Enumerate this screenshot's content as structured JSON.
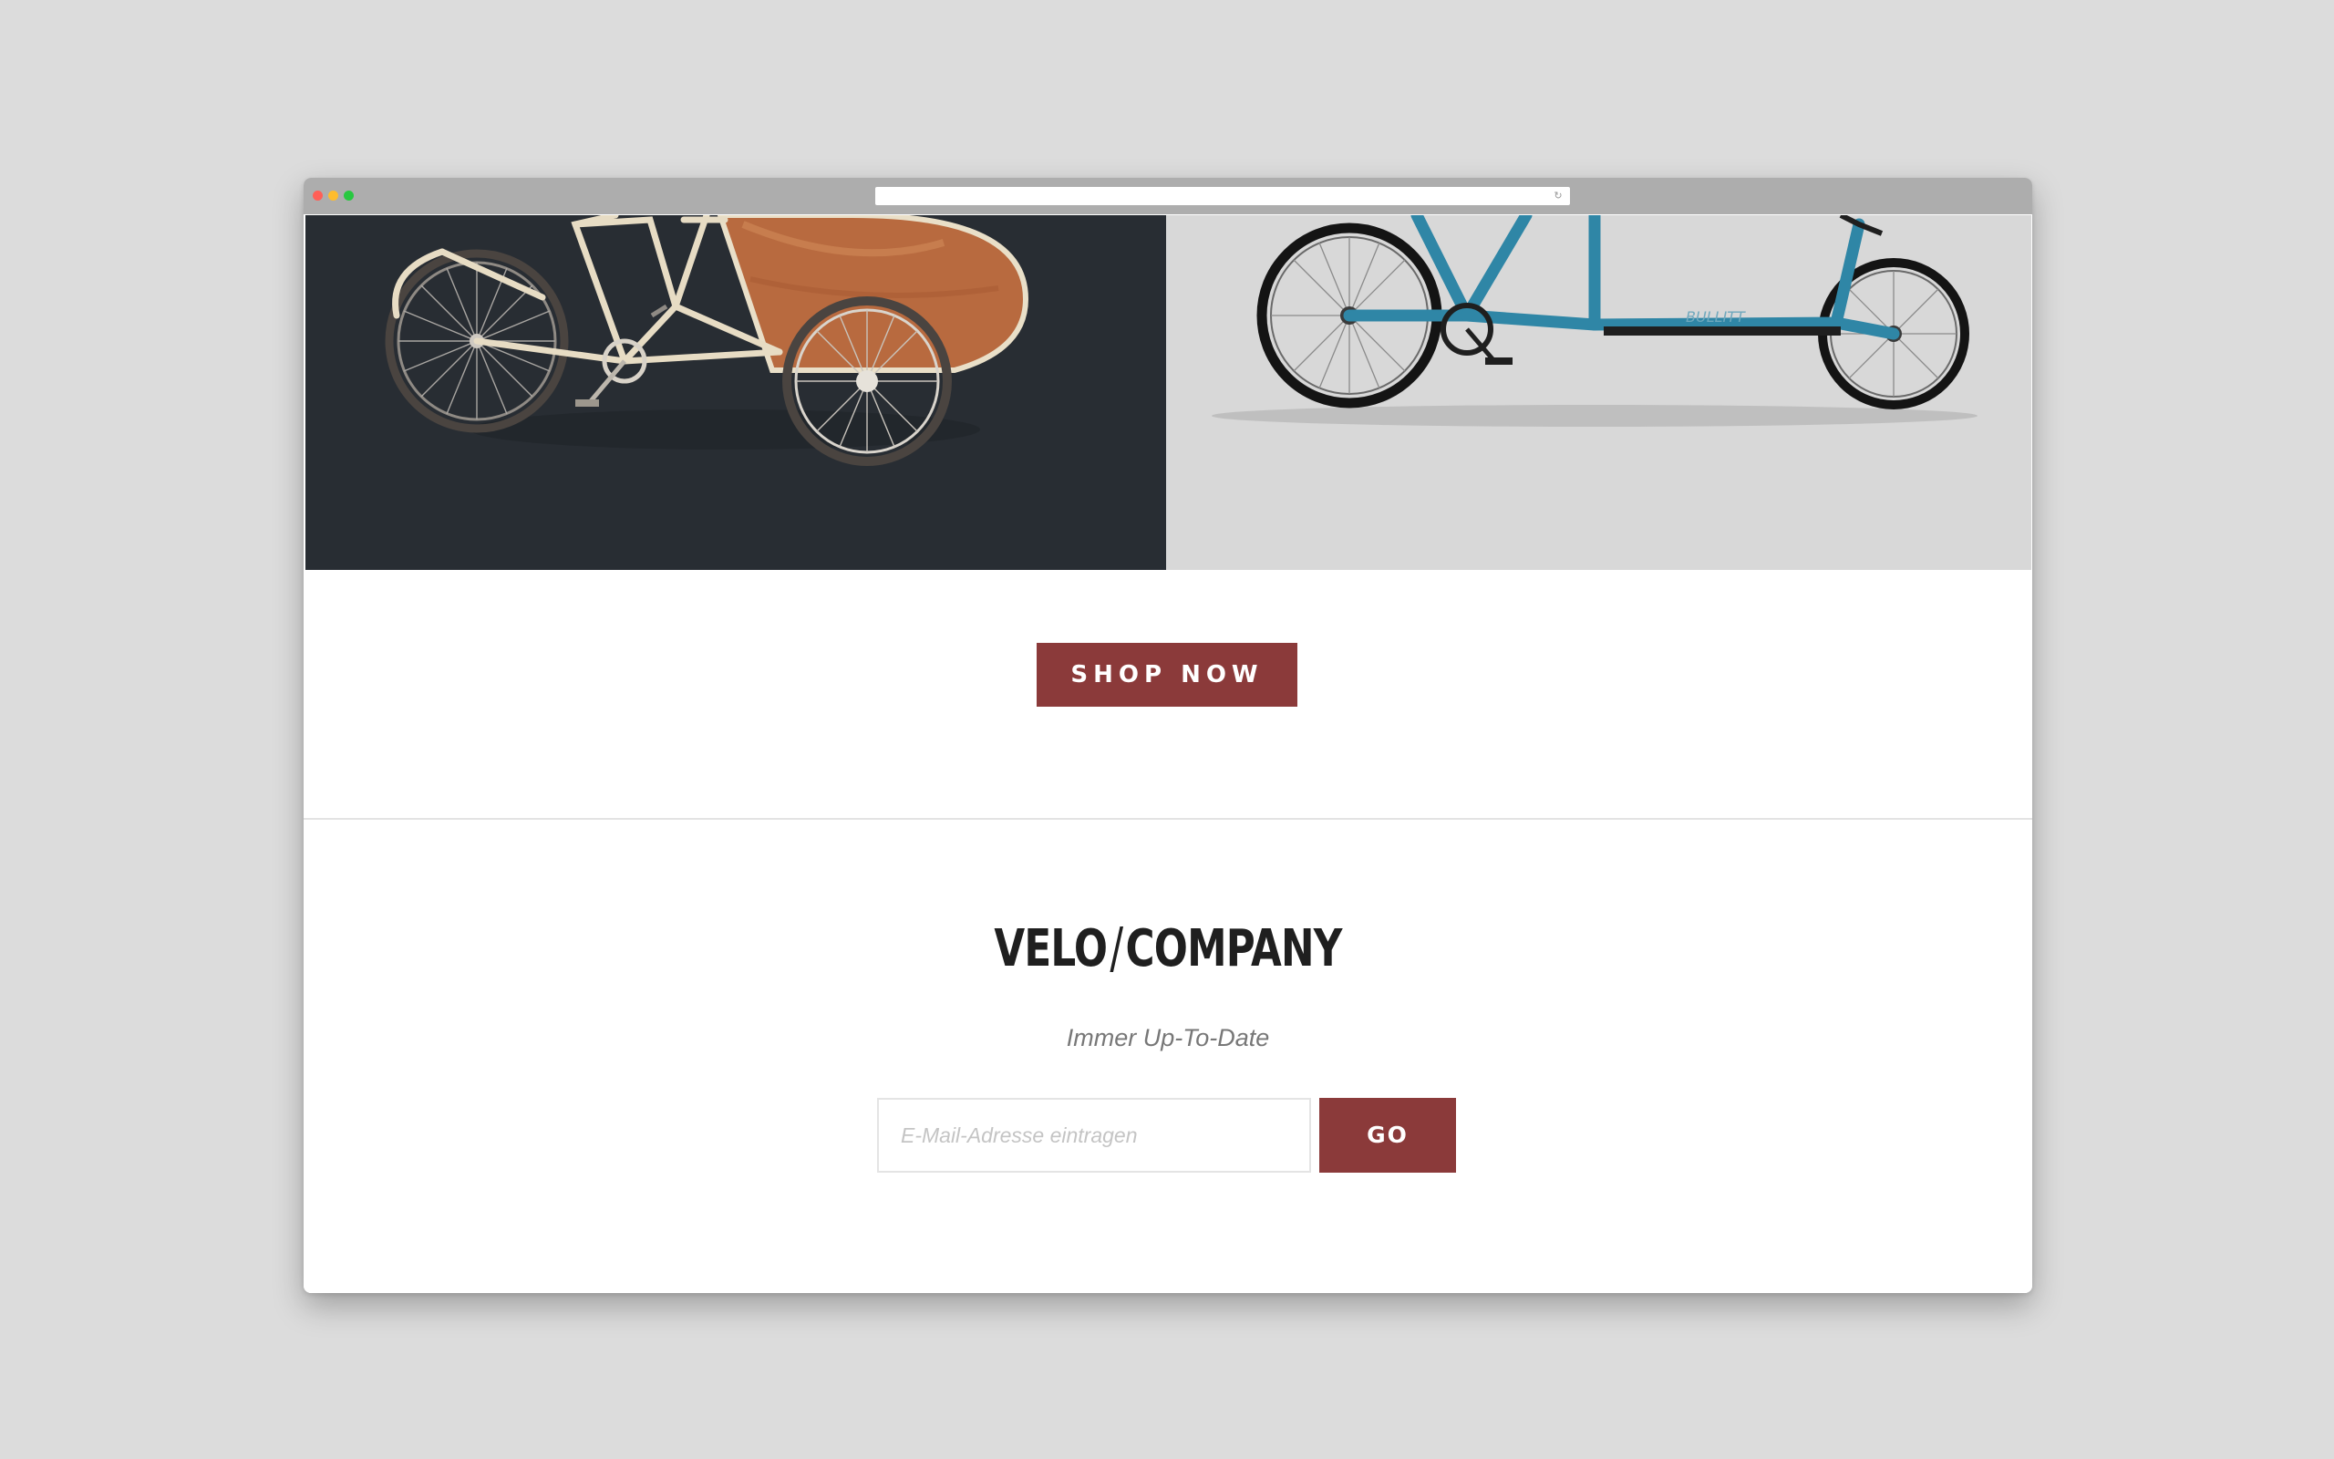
{
  "browser": {
    "dots": [
      "red",
      "yellow",
      "green"
    ],
    "reload_icon": "↻"
  },
  "hero": {
    "left_image_icon": "cargo-tricycle-icon",
    "right_image_icon": "cargo-bike-icon",
    "left_brand_color": "#282d33",
    "right_brand_color": "#d8d8d8",
    "right_bike_brand_text": "BULLITT"
  },
  "cta": {
    "shop_now_label": "SHOP NOW",
    "accent_color": "#8b3a3a"
  },
  "newsletter": {
    "logo_left": "VELO",
    "logo_slash": "/",
    "logo_right": "COMPANY",
    "tagline": "Immer Up-To-Date",
    "email_placeholder": "E-Mail-Adresse eintragen",
    "go_label": "GO"
  }
}
